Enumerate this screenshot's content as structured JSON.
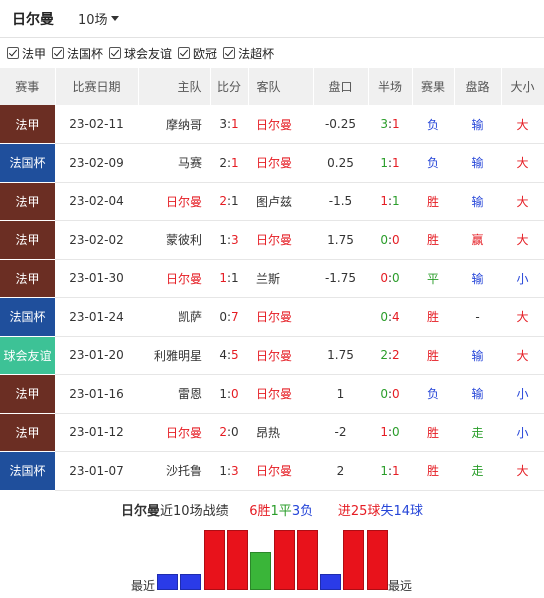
{
  "header": {
    "team": "日尔曼",
    "count_select": "10场"
  },
  "filters": [
    "法甲",
    "法国杯",
    "球会友谊",
    "欧冠",
    "法超杯"
  ],
  "columns": [
    "赛事",
    "比赛日期",
    "主队",
    "比分",
    "客队",
    "盘口",
    "半场",
    "赛果",
    "盘路",
    "大小"
  ],
  "colors": {
    "法甲": "#6b2e23",
    "法国杯": "#1f4f9c",
    "球会友谊": "#3dc296",
    "red": "#e51c23",
    "green": "#2a9d2a",
    "blue": "#2545d8",
    "bar_win": "#e8121b",
    "bar_draw": "#3ab539",
    "bar_loss": "#2a3be8"
  },
  "matches": [
    {
      "event": "法甲",
      "date": "23-02-11",
      "home": "摩纳哥",
      "score_h": "3",
      "score_a": "1",
      "away": "日尔曼",
      "psg_home": false,
      "handicap": "-0.25",
      "ht_h": "3",
      "ht_a": "1",
      "result": "负",
      "cover": "输",
      "ou": "大"
    },
    {
      "event": "法国杯",
      "date": "23-02-09",
      "home": "马赛",
      "score_h": "2",
      "score_a": "1",
      "away": "日尔曼",
      "psg_home": false,
      "handicap": "0.25",
      "ht_h": "1",
      "ht_a": "1",
      "result": "负",
      "cover": "输",
      "ou": "大"
    },
    {
      "event": "法甲",
      "date": "23-02-04",
      "home": "日尔曼",
      "score_h": "2",
      "score_a": "1",
      "away": "图卢兹",
      "psg_home": true,
      "handicap": "-1.5",
      "ht_h": "1",
      "ht_a": "1",
      "result": "胜",
      "cover": "输",
      "ou": "大"
    },
    {
      "event": "法甲",
      "date": "23-02-02",
      "home": "蒙彼利",
      "score_h": "1",
      "score_a": "3",
      "away": "日尔曼",
      "psg_home": false,
      "handicap": "1.75",
      "ht_h": "0",
      "ht_a": "0",
      "result": "胜",
      "cover": "赢",
      "ou": "大"
    },
    {
      "event": "法甲",
      "date": "23-01-30",
      "home": "日尔曼",
      "score_h": "1",
      "score_a": "1",
      "away": "兰斯",
      "psg_home": true,
      "handicap": "-1.75",
      "ht_h": "0",
      "ht_a": "0",
      "result": "平",
      "cover": "输",
      "ou": "小"
    },
    {
      "event": "法国杯",
      "date": "23-01-24",
      "home": "凯萨",
      "score_h": "0",
      "score_a": "7",
      "away": "日尔曼",
      "psg_home": false,
      "handicap": "",
      "ht_h": "0",
      "ht_a": "4",
      "result": "胜",
      "cover": "-",
      "ou": "大"
    },
    {
      "event": "球会友谊",
      "date": "23-01-20",
      "home": "利雅明星",
      "score_h": "4",
      "score_a": "5",
      "away": "日尔曼",
      "psg_home": false,
      "handicap": "1.75",
      "ht_h": "2",
      "ht_a": "2",
      "result": "胜",
      "cover": "输",
      "ou": "大"
    },
    {
      "event": "法甲",
      "date": "23-01-16",
      "home": "雷恩",
      "score_h": "1",
      "score_a": "0",
      "away": "日尔曼",
      "psg_home": false,
      "handicap": "1",
      "ht_h": "0",
      "ht_a": "0",
      "result": "负",
      "cover": "输",
      "ou": "小"
    },
    {
      "event": "法甲",
      "date": "23-01-12",
      "home": "日尔曼",
      "score_h": "2",
      "score_a": "0",
      "away": "昂热",
      "psg_home": true,
      "handicap": "-2",
      "ht_h": "1",
      "ht_a": "0",
      "result": "胜",
      "cover": "走",
      "ou": "小"
    },
    {
      "event": "法国杯",
      "date": "23-01-07",
      "home": "沙托鲁",
      "score_h": "1",
      "score_a": "3",
      "away": "日尔曼",
      "psg_home": false,
      "handicap": "2",
      "ht_h": "1",
      "ht_a": "1",
      "result": "胜",
      "cover": "走",
      "ou": "大"
    }
  ],
  "summary": {
    "team": "日尔曼",
    "recent_label": "近10场战绩",
    "wins": "6胜",
    "draws": "1平",
    "losses": "3负",
    "goals_for": "进25球",
    "goals_against": "失14球"
  },
  "trend": {
    "label_left": "最近",
    "label_right": "最远",
    "results": [
      "负",
      "负",
      "胜",
      "胜",
      "平",
      "胜",
      "胜",
      "负",
      "胜",
      "胜"
    ]
  }
}
